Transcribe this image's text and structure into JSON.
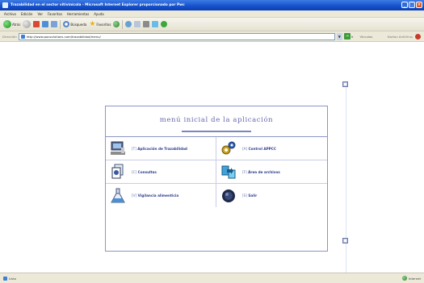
{
  "window": {
    "title": "Trazabilidad en el sector vitivinícola - Microsoft Internet Explorer proporcionado por Pwc"
  },
  "menubar": {
    "items": [
      "Archivo",
      "Edición",
      "Ver",
      "Favoritos",
      "Herramientas",
      "Ayuda"
    ]
  },
  "toolbar": {
    "back_label": "Atrás",
    "search_label": "Búsqueda",
    "favorites_label": "Favoritos"
  },
  "address": {
    "label": "Dirección",
    "url": "http://www.pocsolutions.com/trazabilidad/menu/",
    "go_label": "Ir",
    "links_label": "Vínculos",
    "search_text": "Norton AntiVirus"
  },
  "menu": {
    "title": "menú inicial de la aplicación",
    "items": [
      {
        "key": "[T]",
        "label": "Aplicación de Trazabilidad",
        "icon": "computer-icon"
      },
      {
        "key": "[A]",
        "label": "Control APPCC",
        "icon": "gears-icon"
      },
      {
        "key": "[C]",
        "label": "Consultas",
        "icon": "documents-icon"
      },
      {
        "key": "[F]",
        "label": "Área de archivos",
        "icon": "file-transfer-icon"
      },
      {
        "key": "[V]",
        "label": "Vigilancia alimenticia",
        "icon": "flask-icon"
      },
      {
        "key": "[S]",
        "label": "Salir",
        "icon": "exit-icon"
      }
    ]
  },
  "status": {
    "left": "Listo",
    "right": "Internet"
  },
  "colors": {
    "menu_border": "#8b95c4",
    "menu_title": "#6868b0",
    "link_text": "#2b3c8c",
    "titlebar": "#1550c9"
  }
}
